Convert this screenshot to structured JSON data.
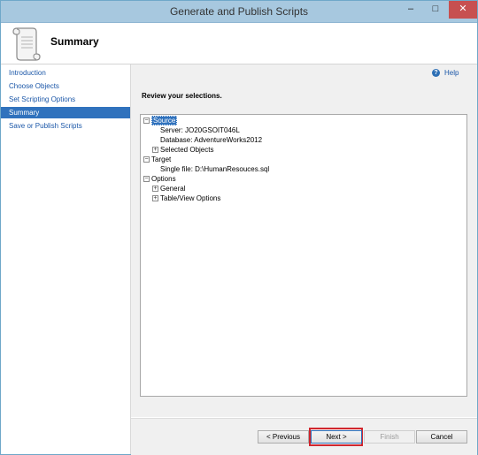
{
  "window": {
    "title": "Generate and Publish Scripts",
    "minimize": "–",
    "maximize": "□",
    "close": "✕"
  },
  "header": {
    "title": "Summary",
    "icon": "scroll-icon"
  },
  "nav": {
    "items": [
      {
        "label": "Introduction",
        "selected": false
      },
      {
        "label": "Choose Objects",
        "selected": false
      },
      {
        "label": "Set Scripting Options",
        "selected": false
      },
      {
        "label": "Summary",
        "selected": true
      },
      {
        "label": "Save or Publish Scripts",
        "selected": false
      }
    ]
  },
  "content": {
    "help_label": "Help",
    "review_label": "Review your selections.",
    "tree": {
      "source": "Source",
      "server": "Server: JO20GSOIT046L",
      "database": "Database: AdventureWorks2012",
      "selected_objects": "Selected Objects",
      "target": "Target",
      "single_file": "Single file: D:\\HumanResouces.sql",
      "options": "Options",
      "general": "General",
      "table_view_options": "Table/View Options"
    }
  },
  "footer": {
    "previous": "< Previous",
    "next": "Next >",
    "finish": "Finish",
    "cancel": "Cancel"
  },
  "colors": {
    "accent": "#3072bd",
    "highlight": "#d0262e",
    "titlebar": "#a7c8df"
  }
}
